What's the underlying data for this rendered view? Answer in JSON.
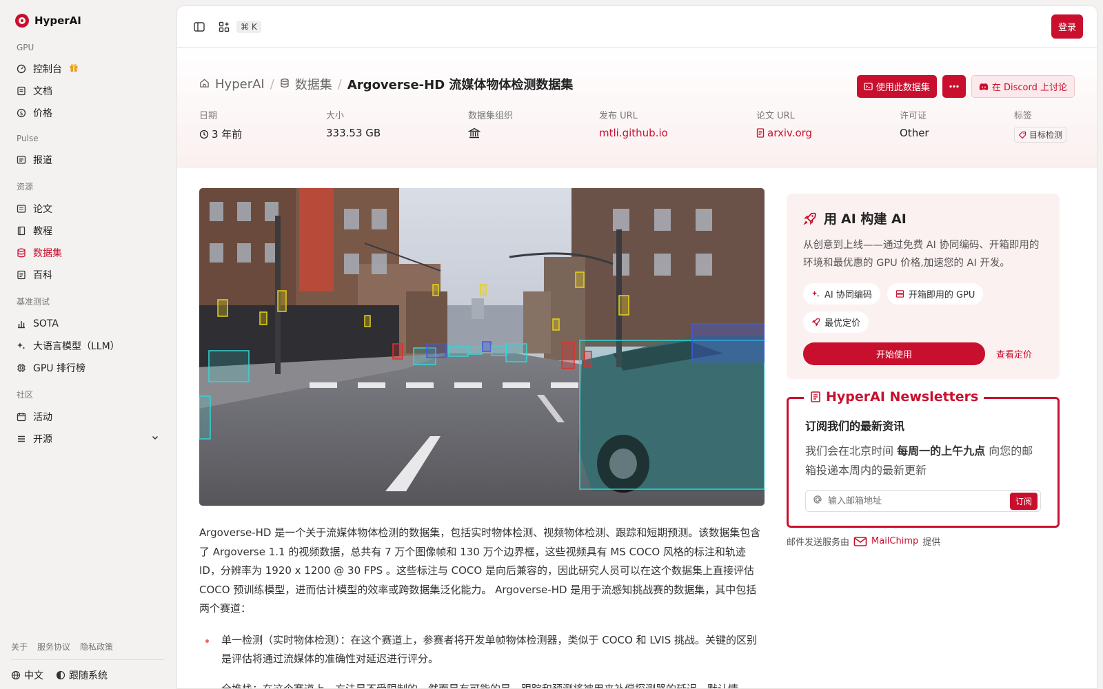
{
  "brand": {
    "name": "HyperAI"
  },
  "sidebar": {
    "sections": [
      {
        "label": "GPU",
        "items": [
          {
            "label": "控制台",
            "icon": "gauge-icon"
          },
          {
            "label": "文档",
            "icon": "doc-icon"
          },
          {
            "label": "价格",
            "icon": "dollar-icon"
          }
        ]
      },
      {
        "label": "Pulse",
        "items": [
          {
            "label": "报道",
            "icon": "news-icon"
          }
        ]
      },
      {
        "label": "资源",
        "items": [
          {
            "label": "论文",
            "icon": "paper-icon"
          },
          {
            "label": "教程",
            "icon": "book-icon"
          },
          {
            "label": "数据集",
            "icon": "database-icon",
            "active": true
          },
          {
            "label": "百科",
            "icon": "wiki-icon"
          }
        ]
      },
      {
        "label": "基准测试",
        "items": [
          {
            "label": "SOTA",
            "icon": "bar-chart-icon"
          },
          {
            "label": "大语言模型（LLM）",
            "icon": "sparkles-icon"
          },
          {
            "label": "GPU 排行榜",
            "icon": "cpu-icon"
          }
        ]
      },
      {
        "label": "社区",
        "items": [
          {
            "label": "活动",
            "icon": "calendar-icon"
          },
          {
            "label": "开源",
            "icon": "list-icon"
          }
        ]
      }
    ],
    "footer_links": [
      "关于",
      "服务协议",
      "隐私政策"
    ],
    "language": "中文",
    "theme": "跟随系统"
  },
  "topbar": {
    "shortcut": "⌘ K",
    "login": "登录"
  },
  "breadcrumb": {
    "home": "HyperAI",
    "section": "数据集",
    "current": "Argoverse-HD 流媒体物体检测数据集"
  },
  "actions": {
    "use_dataset": "使用此数据集",
    "discord": "在 Discord 上讨论"
  },
  "meta": {
    "date_label": "日期",
    "date_value": "3 年前",
    "size_label": "大小",
    "size_value": "333.53 GB",
    "org_label": "数据集组织",
    "pub_label": "发布 URL",
    "pub_value": "mtli.github.io",
    "paper_label": "论文 URL",
    "paper_value": "arxiv.org",
    "license_label": "许可证",
    "license_value": "Other",
    "tags_label": "标签",
    "tag_value": "目标检测"
  },
  "description": "Argoverse-HD 是一个关于流媒体物体检测的数据集，包括实时物体检测、视频物体检测、跟踪和短期预测。该数据集包含了 Argoverse 1.1 的视频数据，总共有 7 万个图像帧和 130 万个边界框，这些视频具有 MS COCO 风格的标注和轨迹 ID，分辨率为 1920 x 1200 @ 30 FPS 。这些标注与 COCO 是向后兼容的，因此研究人员可以在这个数据集上直接评估 COCO 预训练模型，进而估计模型的效率或跨数据集泛化能力。 Argoverse-HD 是用于流感知挑战赛的数据集，其中包括两个赛道：",
  "bullets": [
    "单一检测（实时物体检测）：在这个赛道上，参赛者将开发单帧物体检测器，类似于 COCO 和 LVIS 挑战。关键的区别是评估将通过流媒体的准确性对延迟进行评分。",
    "全堆栈：在这个赛道上，方法是不受限制的，然而是有可能的是，跟踪和预测将被用来补偿探测器的延迟。默认情"
  ],
  "promo": {
    "title_prefix": "用",
    "title_strong": "AI 构建 AI",
    "desc": "从创意到上线——通过免费 AI 协同编码、开箱即用的环境和最优惠的 GPU 价格,加速您的 AI 开发。",
    "chips": [
      "AI 协同编码",
      "开箱即用的 GPU",
      "最优定价"
    ],
    "start": "开始使用",
    "pricing": "查看定价"
  },
  "newsletter": {
    "legend": "HyperAI Newsletters",
    "heading": "订阅我们的最新资讯",
    "text_before": "我们会在北京时间",
    "text_bold": "每周一的上午九点",
    "text_after": "向您的邮箱投递本周内的最新更新",
    "placeholder": "输入邮箱地址",
    "subscribe": "订阅",
    "by_prefix": "邮件发送服务由",
    "by_name": "MailChimp",
    "by_suffix": "提供"
  },
  "colors": {
    "accent": "#c8102e",
    "box_cyan": "#33d6d6",
    "box_yellow": "#e8d21a",
    "box_red": "#e03030",
    "box_blue": "#3b5ce0"
  }
}
